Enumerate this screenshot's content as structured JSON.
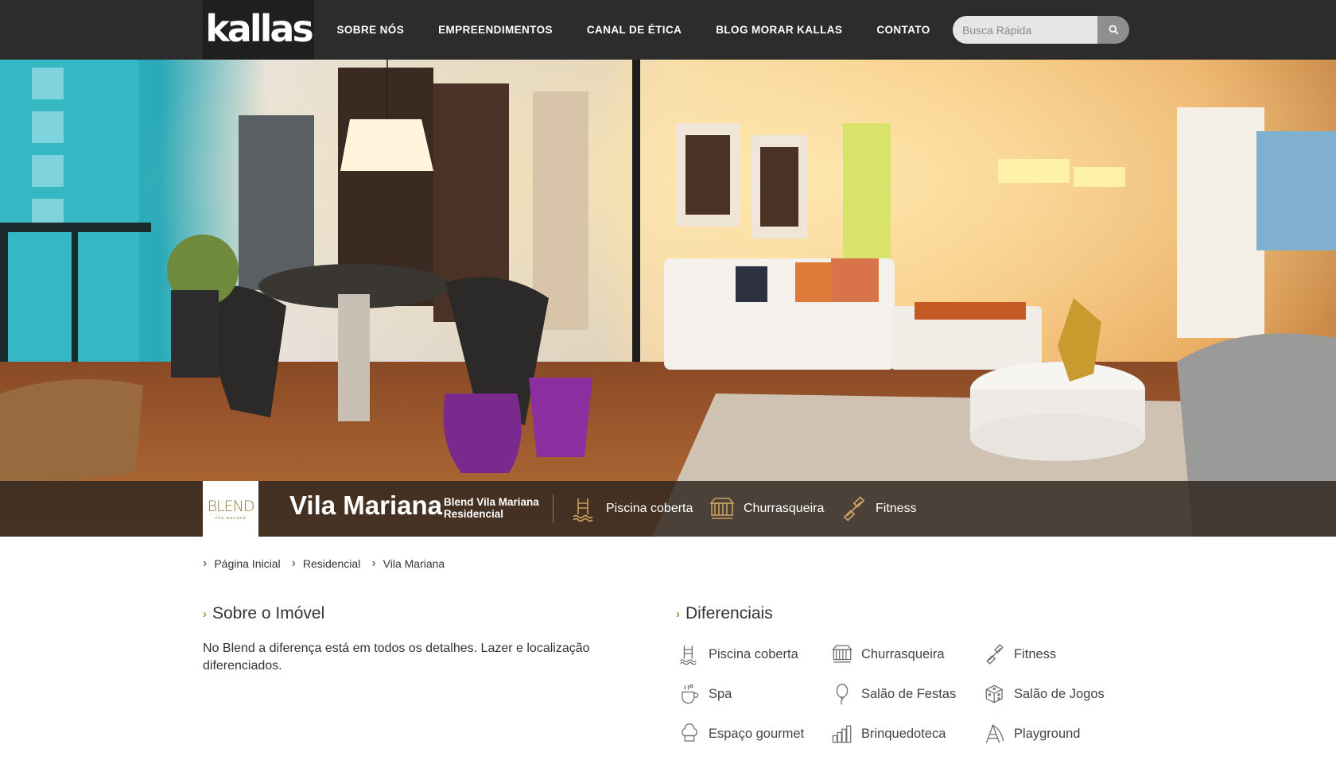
{
  "header": {
    "logo_text": "kallas",
    "nav": [
      {
        "label": "SOBRE NÓS"
      },
      {
        "label": "EMPREENDIMENTOS"
      },
      {
        "label": "CANAL DE ÉTICA"
      },
      {
        "label": "BLOG MORAR KALLAS"
      },
      {
        "label": "CONTATO"
      }
    ],
    "search": {
      "placeholder": "Busca Rápida",
      "icon": "search-icon"
    }
  },
  "hero": {
    "logo": {
      "word": "BLEND",
      "sub": "vila mariana"
    },
    "title": "Vila Mariana",
    "subtitle_line1": "Blend Vila Mariana",
    "subtitle_line2": "Residencial",
    "features": [
      {
        "label": "Piscina coberta",
        "icon": "pool-icon"
      },
      {
        "label": "Churrasqueira",
        "icon": "grill-icon"
      },
      {
        "label": "Fitness",
        "icon": "dumbbell-icon"
      }
    ]
  },
  "breadcrumb": [
    {
      "label": "Página Inicial"
    },
    {
      "label": "Residencial"
    },
    {
      "label": "Vila Mariana"
    }
  ],
  "about": {
    "title": "Sobre o Imóvel",
    "text": "No Blend a diferença está em todos os detalhes. Lazer e localização diferenciados."
  },
  "differentials": {
    "title": "Diferenciais",
    "items": [
      {
        "label": "Piscina coberta",
        "icon": "pool-icon"
      },
      {
        "label": "Churrasqueira",
        "icon": "grill-icon"
      },
      {
        "label": "Fitness",
        "icon": "dumbbell-icon"
      },
      {
        "label": "Spa",
        "icon": "spa-icon"
      },
      {
        "label": "Salão de Festas",
        "icon": "balloon-icon"
      },
      {
        "label": "Salão de Jogos",
        "icon": "dice-icon"
      },
      {
        "label": "Espaço gourmet",
        "icon": "chef-hat-icon"
      },
      {
        "label": "Brinquedoteca",
        "icon": "toys-icon"
      },
      {
        "label": "Playground",
        "icon": "playground-icon"
      }
    ]
  },
  "colors": {
    "topbar": "#2c2c2c",
    "accent": "#b08a50",
    "text": "#333333"
  }
}
